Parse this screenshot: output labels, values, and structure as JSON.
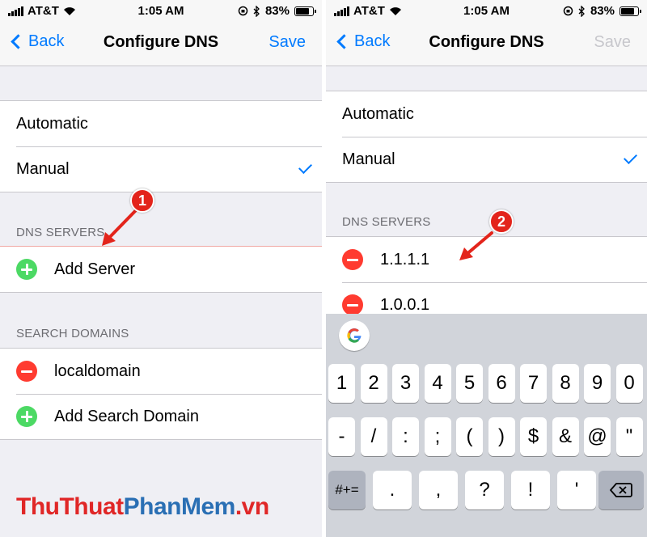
{
  "left_screen": {
    "status": {
      "carrier": "AT&T",
      "time": "1:05 AM",
      "battery": "83%",
      "battery_level": 0.83
    },
    "nav": {
      "back_label": "Back",
      "title": "Configure DNS",
      "save_label": "Save"
    },
    "mode_options": [
      {
        "label": "Automatic",
        "checked": false
      },
      {
        "label": "Manual",
        "checked": true
      }
    ],
    "dns_servers_header": "DNS SERVERS",
    "add_server_label": "Add Server",
    "search_domains_header": "SEARCH DOMAINS",
    "search_domains": [
      "localdomain"
    ],
    "add_search_domain_label": "Add Search Domain",
    "callout": "1"
  },
  "right_screen": {
    "status": {
      "carrier": "AT&T",
      "time": "1:05 AM",
      "battery": "83%",
      "battery_level": 0.83
    },
    "nav": {
      "back_label": "Back",
      "title": "Configure DNS",
      "save_label": "Save",
      "save_disabled": true
    },
    "mode_options": [
      {
        "label": "Automatic",
        "checked": false
      },
      {
        "label": "Manual",
        "checked": true
      }
    ],
    "dns_servers_header": "DNS SERVERS",
    "dns_servers": [
      "1.1.1.1",
      "1.0.0.1"
    ],
    "callout": "2",
    "keyboard": {
      "row1": [
        "1",
        "2",
        "3",
        "4",
        "5",
        "6",
        "7",
        "8",
        "9",
        "0"
      ],
      "row2": [
        "-",
        "/",
        ":",
        ";",
        "(",
        ")",
        "$",
        "&",
        "@",
        "\""
      ],
      "row3_left": "#+=",
      "row3": [
        ".",
        ",",
        "?",
        "!",
        "'"
      ],
      "delete_icon": "backspace-icon"
    }
  },
  "watermark": {
    "part1": "ThuThuat",
    "part2": "PhanMem",
    "part3": ".vn"
  },
  "colors": {
    "accent": "#007aff",
    "add": "#4cd964",
    "remove": "#ff3b30",
    "callout": "#e3241b"
  }
}
